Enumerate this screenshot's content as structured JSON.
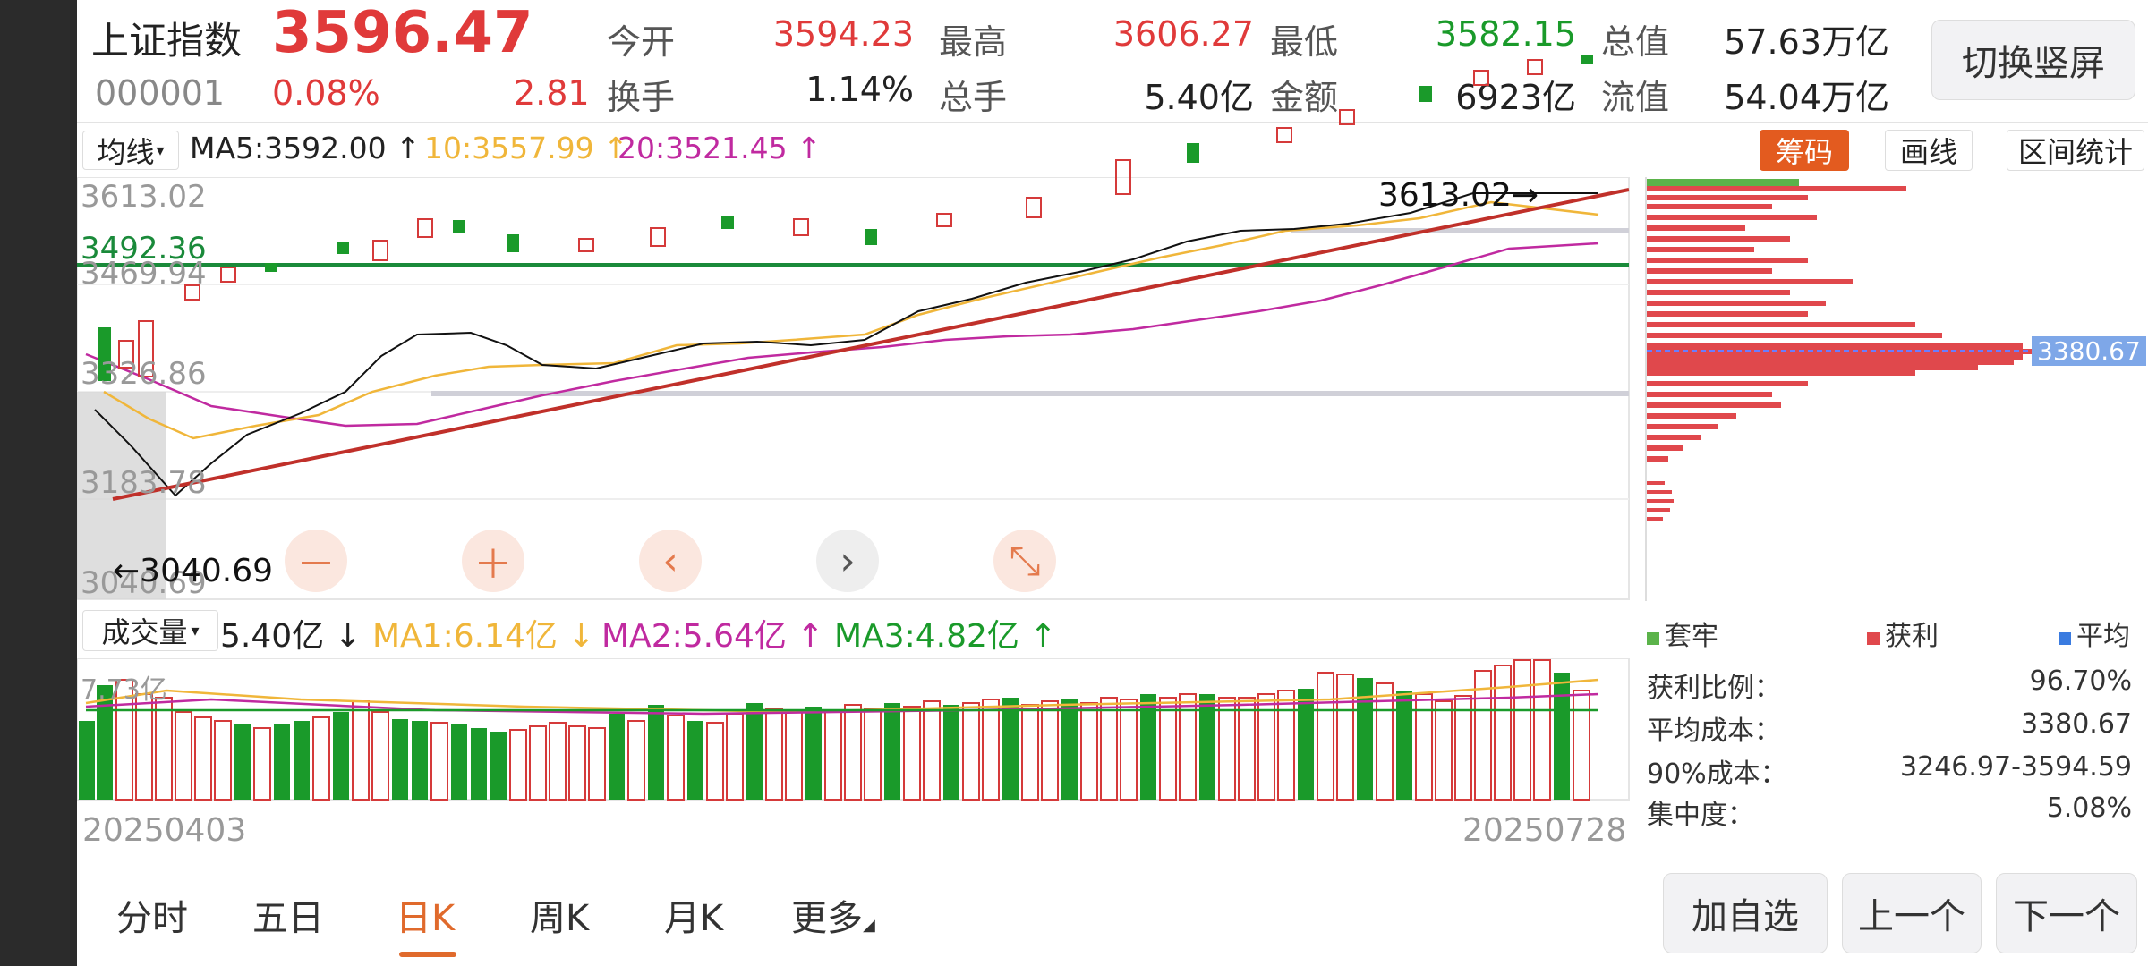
{
  "header": {
    "index_name": "上证指数",
    "price": "3596.47",
    "code": "000001",
    "change_pct": "0.08%",
    "change_abs": "2.81",
    "stats": [
      {
        "label": "今开",
        "value": "3594.23",
        "color": "red"
      },
      {
        "label": "最高",
        "value": "3606.27",
        "color": "red"
      },
      {
        "label": "最低",
        "value": "3582.15",
        "color": "green"
      },
      {
        "label": "总值",
        "value": "57.63万亿",
        "color": "black"
      },
      {
        "label": "换手",
        "value": "1.14%",
        "color": "black"
      },
      {
        "label": "总手",
        "value": "5.40亿",
        "color": "black"
      },
      {
        "label": "金额",
        "value": "6923亿",
        "color": "black"
      },
      {
        "label": "流值",
        "value": "54.04万亿",
        "color": "black"
      }
    ],
    "switch_button": "切换竖屏"
  },
  "ma_bar": {
    "selector": "均线",
    "ma5": "MA5:3592.00",
    "ma10": "10:3557.99",
    "ma20": "20:3521.45",
    "arrow": "↑"
  },
  "chart_tools": {
    "chips": "筹码",
    "draw": "画线",
    "range_stats": "区间统计"
  },
  "kline": {
    "y_labels": [
      "3613.02",
      "3492.36",
      "3469.94",
      "3326.86",
      "3183.78",
      "3040.69"
    ],
    "high_label": "3613.02",
    "low_label": "3040.69",
    "chip_price": "3380.67",
    "controls": {
      "minus": "－",
      "plus": "＋",
      "left": "‹",
      "right": "›",
      "shrink": "⤡"
    }
  },
  "volume_bar": {
    "selector": "成交量",
    "vol": "5.40亿 ↓",
    "ma1": "MA1:6.14亿 ↓",
    "ma2": "MA2:5.64亿 ↑",
    "ma3": "MA3:4.82亿 ↑",
    "y_label": "7.73亿"
  },
  "dates": {
    "start": "20250403",
    "end": "20250728"
  },
  "chips_legend": {
    "trapped": "套牢",
    "profit": "获利",
    "average": "平均"
  },
  "chips_stats": [
    {
      "label": "获利比例：",
      "value": "96.70%"
    },
    {
      "label": "平均成本：",
      "value": "3380.67"
    },
    {
      "label": "90%成本：",
      "value": "3246.97-3594.59"
    },
    {
      "label": "集中度：",
      "value": "5.08%"
    }
  ],
  "tabs": [
    "分时",
    "五日",
    "日K",
    "周K",
    "月K",
    "更多"
  ],
  "active_tab": "日K",
  "bottom_buttons": {
    "add": "加自选",
    "prev": "上一个",
    "next": "下一个"
  },
  "colors": {
    "up": "#e03a3a",
    "down": "#1a9a2a",
    "accent": "#e06a2c",
    "ma5": "#222222",
    "ma10": "#f0b63a",
    "ma20": "#c02aa0"
  }
}
